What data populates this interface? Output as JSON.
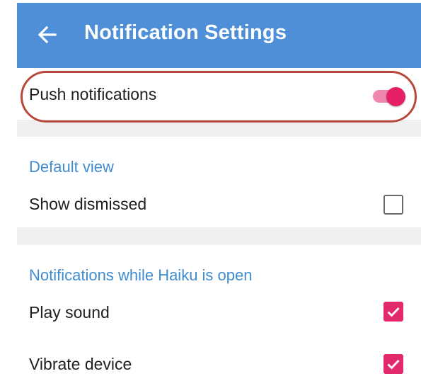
{
  "appbar": {
    "title": "Notification Settings",
    "back_icon": "arrow-left-icon"
  },
  "push": {
    "label": "Push notifications",
    "enabled": true
  },
  "default_view": {
    "section_title": "Default view",
    "show_dismissed_label": "Show dismissed",
    "show_dismissed_checked": false
  },
  "while_open": {
    "section_title": "Notifications while Haiku is open",
    "play_sound_label": "Play sound",
    "play_sound_checked": true,
    "vibrate_label": "Vibrate device",
    "vibrate_checked": true
  },
  "colors": {
    "appbar": "#4e8fd8",
    "accent": "#e62066",
    "section_title": "#3f8cd0",
    "highlight": "#b8473b",
    "background": "#efefef"
  }
}
